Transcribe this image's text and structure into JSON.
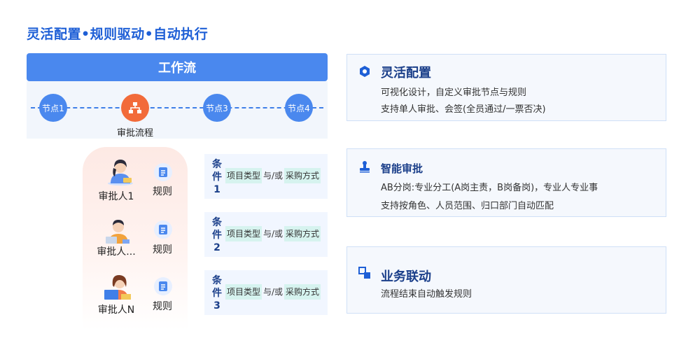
{
  "page": {
    "title": "灵活配置•规则驱动•自动执行"
  },
  "workflow": {
    "header": "工作流",
    "nodes": [
      {
        "label": "节点1"
      },
      {
        "label": "审批流程"
      },
      {
        "label": "节点3"
      },
      {
        "label": "节点4"
      }
    ]
  },
  "approvers": [
    {
      "name": "审批人1",
      "rule": "规则"
    },
    {
      "name": "审批人...",
      "rule": "规则"
    },
    {
      "name": "审批人N",
      "rule": "规则"
    }
  ],
  "conditions": [
    {
      "title": "条件1",
      "tag1": "项目类型",
      "connector": "与/或",
      "tag2": "采购方式"
    },
    {
      "title": "条件2",
      "tag1": "项目类型",
      "connector": "与/或",
      "tag2": "采购方式"
    },
    {
      "title": "条件3",
      "tag1": "项目类型",
      "connector": "与/或",
      "tag2": "采购方式"
    }
  ],
  "cards": [
    {
      "icon": "settings-hex-icon",
      "title": "灵活配置",
      "lines": [
        "可视化设计，自定义审批节点与规则",
        "支持单人审批、会签(全员通过/一票否决)"
      ]
    },
    {
      "icon": "stamp-icon",
      "title": "智能审批",
      "lines": [
        "AB分岗:专业分工(A岗主责，B岗备岗)，专业人专业事",
        "支持按角色、人员范围、归口部门自动匹配"
      ]
    },
    {
      "icon": "link-squares-icon",
      "title": "业务联动",
      "lines": [
        "流程结束自动触发规则"
      ]
    }
  ],
  "colors": {
    "primary": "#4a88ee",
    "title": "#1e5fd6",
    "accent": "#f26b3a",
    "tag": "#d6f3ef"
  }
}
